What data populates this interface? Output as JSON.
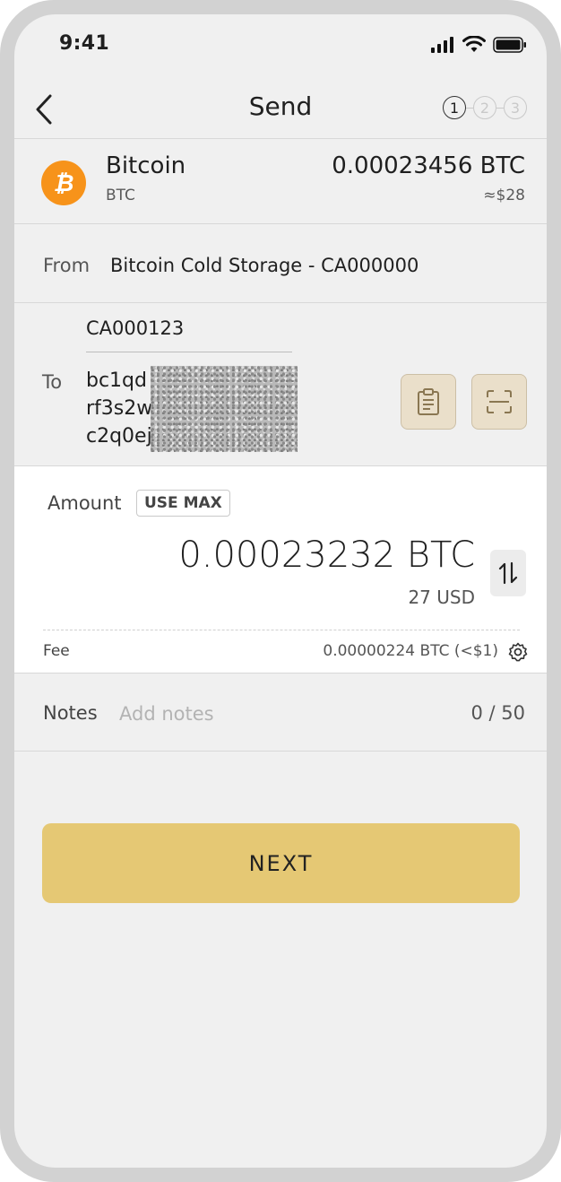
{
  "status_bar": {
    "time": "9:41"
  },
  "header": {
    "title": "Send",
    "steps": [
      "1",
      "2",
      "3"
    ],
    "active_step": 1
  },
  "asset": {
    "name": "Bitcoin",
    "ticker": "BTC",
    "amount": "0.00023456 BTC",
    "fiat": "≈$28",
    "icon": "bitcoin-icon",
    "icon_color": "#f7931a"
  },
  "from": {
    "label": "From",
    "value": "Bitcoin Cold Storage - CA000000"
  },
  "to": {
    "label": "To",
    "address_name": "CA000123",
    "address_lines": [
      "bc1qd",
      "rf3s2w",
      "c2q0ej"
    ],
    "paste_icon": "clipboard-icon",
    "scan_icon": "scan-icon"
  },
  "amount": {
    "label": "Amount",
    "use_max": "USE MAX",
    "value": "0.00023232 BTC",
    "fiat": "27 USD",
    "swap_icon": "swap-arrows-icon",
    "fee_label": "Fee",
    "fee_value": "0.00000224 BTC (<$1)"
  },
  "notes": {
    "label": "Notes",
    "placeholder": "Add notes",
    "counter": "0 / 50"
  },
  "next_button": {
    "label": "NEXT"
  },
  "colors": {
    "accent": "#e5c874",
    "accent_border": "#ccbfa6",
    "background": "#f0f0f0"
  }
}
